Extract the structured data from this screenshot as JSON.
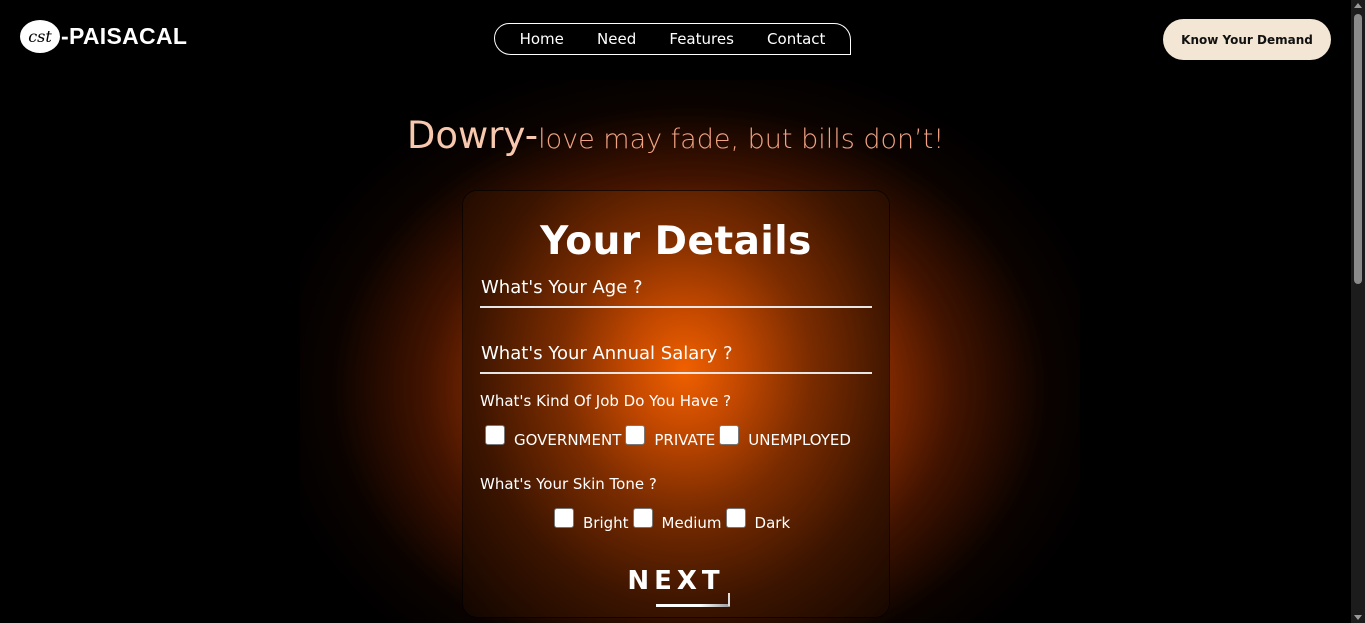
{
  "brand": {
    "logo_glyph": "cst",
    "name": "-PAISACAL"
  },
  "nav": {
    "items": [
      {
        "label": "Home"
      },
      {
        "label": "Need"
      },
      {
        "label": "Features"
      },
      {
        "label": "Contact"
      }
    ]
  },
  "cta": {
    "label": "Know Your Demand"
  },
  "hero": {
    "big": "Dowry-",
    "small": "love may fade, but bills don’t!"
  },
  "form": {
    "title": "Your Details",
    "age_placeholder": "What's Your Age ?",
    "salary_placeholder": "What's Your Annual Salary ?",
    "job_question": "What's Kind Of Job Do You Have ?",
    "job_options": [
      {
        "label": "GOVERNMENT",
        "checked": false
      },
      {
        "label": "PRIVATE",
        "checked": false
      },
      {
        "label": "UNEMPLOYED",
        "checked": false
      }
    ],
    "skin_question": "What's Your Skin Tone ?",
    "skin_options": [
      {
        "label": "Bright",
        "checked": false
      },
      {
        "label": "Medium",
        "checked": false
      },
      {
        "label": "Dark",
        "checked": false
      }
    ],
    "next_label": "NEXT"
  },
  "colors": {
    "background": "#000000",
    "accent_glow": "#f06000",
    "cta_bg": "#f3e6d4",
    "tagline_big": "#f7c8ad",
    "tagline_small": "#f1a383"
  }
}
